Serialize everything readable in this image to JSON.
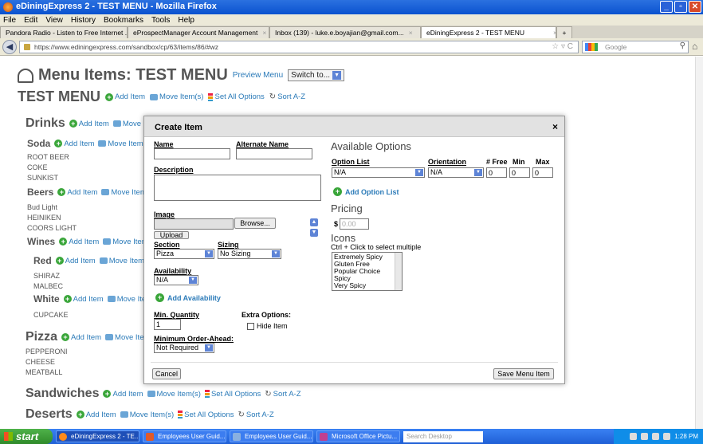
{
  "window": {
    "title": "eDiningExpress 2 - TEST MENU - Mozilla Firefox"
  },
  "menubar": [
    "File",
    "Edit",
    "View",
    "History",
    "Bookmarks",
    "Tools",
    "Help"
  ],
  "tabs": [
    {
      "label": "Pandora Radio - Listen to Free Internet ..."
    },
    {
      "label": "eProspectManager Account Management"
    },
    {
      "label": "Inbox (139) - luke.e.boyajian@gmail.com..."
    },
    {
      "label": "eDiningExpress 2 - TEST MENU"
    }
  ],
  "navbar": {
    "url": "https://www.ediningexpress.com/sandbox/cp/63/items/86/#wz",
    "search_placeholder": "Google"
  },
  "page": {
    "title": "Menu Items: TEST MENU",
    "preview_link": "Preview Menu",
    "switch_label": "Switch to...",
    "menu_name": "TEST MENU",
    "add_item": "Add Item",
    "move_items": "Move Item(s)",
    "set_all_options": "Set All Options",
    "sort": "Sort A-Z",
    "move_trunc": "Move It",
    "move_item_trunc": "Move Item(",
    "move_item_trunc2": "Move Item",
    "move_iten_trunc": "Move Iten",
    "sections": {
      "drinks": "Drinks",
      "soda": "Soda",
      "beers": "Beers",
      "wines": "Wines",
      "red": "Red",
      "white": "White",
      "pizza": "Pizza",
      "sandwiches": "Sandwiches",
      "deserts": "Deserts"
    },
    "items": {
      "soda": [
        "ROOT BEER",
        "COKE",
        "SUNKIST"
      ],
      "beers": [
        "Bud Light",
        "HEINIKEN",
        "COORS LIGHT"
      ],
      "red": [
        "SHIRAZ",
        "MALBEC"
      ],
      "white": [
        "CUPCAKE"
      ],
      "pizza": [
        "PEPPERONI",
        "CHEESE",
        "MEATBALL"
      ]
    }
  },
  "modal": {
    "title": "Create Item",
    "close": "×",
    "name_label": "Name",
    "alt_name_label": "Alternate Name",
    "description_label": "Description",
    "image_label": "Image",
    "browse": "Browse...",
    "upload": "Upload",
    "section_label": "Section",
    "section_value": "Pizza",
    "sizing_label": "Sizing",
    "sizing_value": "No Sizing",
    "availability_label": "Availability",
    "availability_value": "N/A",
    "add_availability": "Add Availability",
    "min_qty_label": "Min. Quantity",
    "min_qty_value": "1",
    "extra_options_label": "Extra Options:",
    "hide_item": "Hide Item",
    "min_order_label": "Minimum Order-Ahead:",
    "min_order_value": "Not Required",
    "available_options_heading": "Available Options",
    "option_list_label": "Option List",
    "option_list_value": "N/A",
    "orientation_label": "Orientation",
    "orientation_value": "N/A",
    "free_label": "# Free",
    "min_label": "Min",
    "max_label": "Max",
    "free_value": "0",
    "min_value": "0",
    "max_value": "0",
    "add_option_list": "Add Option List",
    "pricing_heading": "Pricing",
    "currency": "$",
    "price_placeholder": "0.00",
    "icons_heading": "Icons",
    "icons_hint": "Ctrl + Click to select multiple",
    "icons": [
      "Extremely Spicy",
      "Gluten Free",
      "Popular Choice",
      "Spicy",
      "Very Spicy"
    ],
    "cancel": "Cancel",
    "save": "Save Menu Item"
  },
  "taskbar": {
    "start": "start",
    "tasks": [
      "eDiningExpress 2 - TE...",
      "Employees User Guid...",
      "Employees User Guid...",
      "Microsoft Office Pictu..."
    ],
    "search_placeholder": "Search Desktop",
    "clock": "1:28 PM"
  }
}
